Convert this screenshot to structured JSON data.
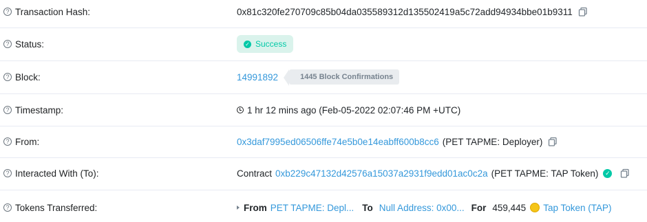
{
  "rows": {
    "tx_hash": {
      "label": "Transaction Hash:",
      "value": "0x81c320fe270709c85b04da035589312d135502419a5c72add94934bbe01b9311"
    },
    "status": {
      "label": "Status:",
      "value": "Success"
    },
    "block": {
      "label": "Block:",
      "number": "14991892",
      "confirmations": "1445 Block Confirmations"
    },
    "timestamp": {
      "label": "Timestamp:",
      "value": "1 hr 12 mins ago (Feb-05-2022 02:07:46 PM +UTC)"
    },
    "from": {
      "label": "From:",
      "address": "0x3daf7995ed06506ffe74e5b0e14eabff600b8cc6",
      "name": "(PET TAPME: Deployer)"
    },
    "interacted": {
      "label": "Interacted With (To):",
      "prefix": "Contract",
      "address": "0xb229c47132d42576a15037a2931f9edd01ac0c2a",
      "name": "(PET TAPME: TAP Token)"
    },
    "tokens": {
      "label": "Tokens Transferred:",
      "from_label": "From",
      "from_value": "PET TAPME: Depl...",
      "to_label": "To",
      "to_value": "Null Address: 0x00...",
      "for_label": "For",
      "amount": "459,445",
      "token": "Tap Token (TAP)"
    }
  },
  "icons": {
    "help": "question-circle-icon",
    "copy": "copy-icon",
    "clock": "clock-icon",
    "check": "check-circle-icon",
    "token": "tap-token-icon"
  },
  "colors": {
    "link": "#3498db",
    "success": "#00c9a7",
    "success_bg": "#daf3ec",
    "divider": "#e7eaf3"
  }
}
